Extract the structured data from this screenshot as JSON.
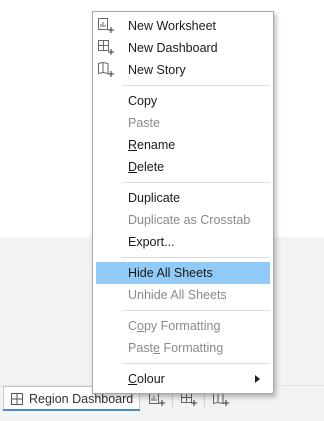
{
  "menu": {
    "new_worksheet": "New Worksheet",
    "new_dashboard": "New Dashboard",
    "new_story": "New Story",
    "copy": "Copy",
    "paste": "Paste",
    "rename_first": "R",
    "rename_rest": "ename",
    "delete_first": "D",
    "delete_rest": "elete",
    "duplicate": "Duplicate",
    "duplicate_crosstab": "Duplicate as Crosstab",
    "export": "Export...",
    "hide_all": "Hide All Sheets",
    "unhide_all": "Unhide All Sheets",
    "copy_fmt_a": "C",
    "copy_fmt_u": "o",
    "copy_fmt_b": "py Formatting",
    "paste_fmt_a": "Past",
    "paste_fmt_u": "e",
    "paste_fmt_b": " Formatting",
    "colour_first": "C",
    "colour_rest": "olour"
  },
  "tabbar": {
    "active_tab": "Region Dashboard"
  },
  "colors": {
    "highlight": "#91c9f7",
    "tab_accent": "#4a8bc9"
  }
}
